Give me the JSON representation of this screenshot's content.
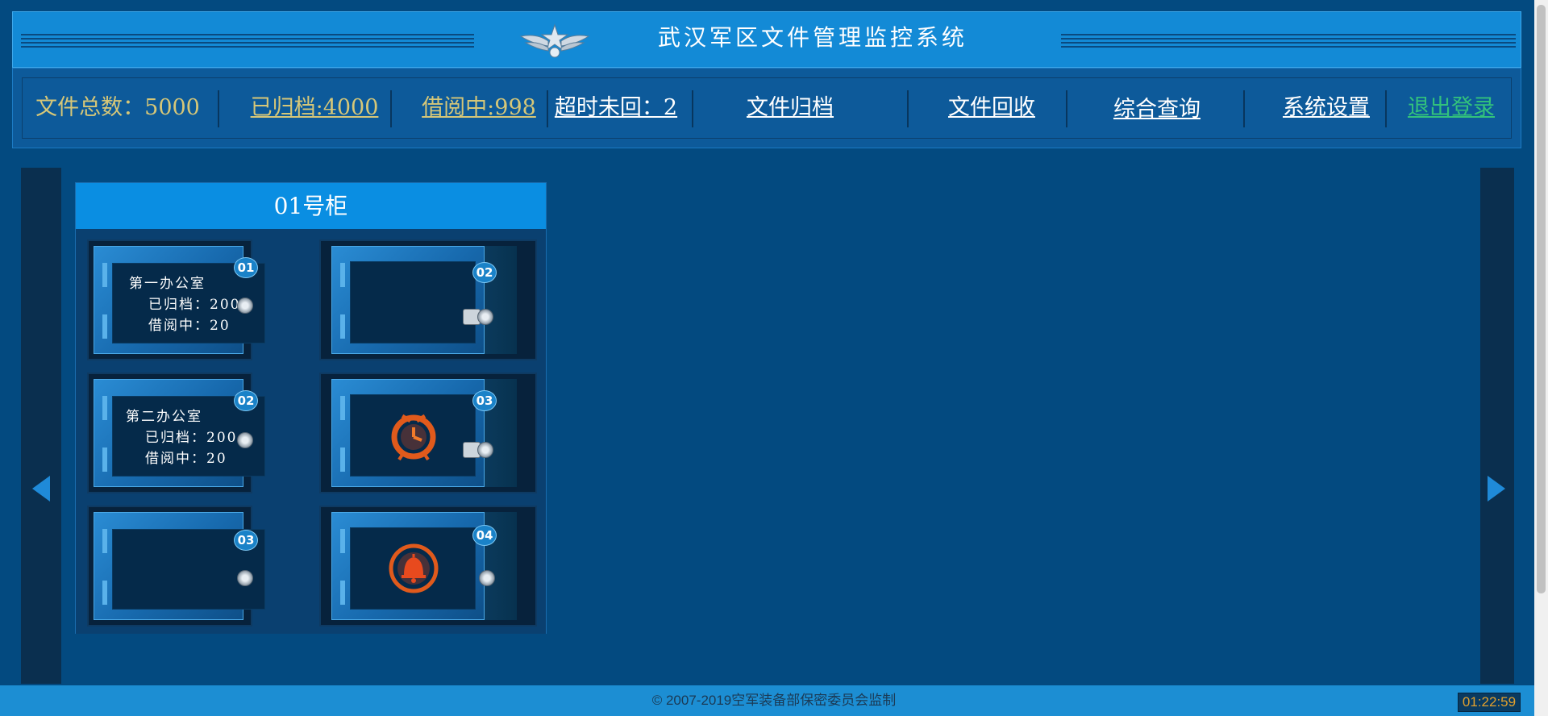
{
  "app": {
    "title": "武汉军区文件管理监控系统",
    "emblem_icon": "air-force-wings-emblem"
  },
  "stats": {
    "total": "文件总数：5000",
    "archived": "已归档:4000",
    "borrowed": "借阅中:998",
    "overdue": "超时未回：2"
  },
  "nav": {
    "archive": "文件归档",
    "recycle": "文件回收",
    "query": "综合查询",
    "settings": "系统设置",
    "logout": "退出登录"
  },
  "cabinet": {
    "title": "01号柜",
    "safes": [
      {
        "number": "01",
        "state": "closed",
        "office": "第一办公室",
        "archived": "已归档：200",
        "borrowed": "借阅中：20"
      },
      {
        "number": "02",
        "state": "open",
        "icon": "none"
      },
      {
        "number": "02",
        "state": "closed",
        "office": "第二办公室",
        "archived": "已归档：200",
        "borrowed": "借阅中：20"
      },
      {
        "number": "03",
        "state": "open",
        "icon": "alarm-clock-icon"
      },
      {
        "number": "03",
        "state": "closed",
        "office": "",
        "archived": "",
        "borrowed": ""
      },
      {
        "number": "04",
        "state": "open",
        "icon": "alarm-bell-icon"
      }
    ]
  },
  "footer": {
    "copyright": "© 2007-2019空军装备部保密委员会监制"
  },
  "clock": "01:22:59",
  "colors": {
    "background": "#034a80",
    "header": "#138ad6",
    "accent_gold": "#d6c778",
    "accent_green": "#32c27c",
    "alarm": "#e05a1c"
  }
}
